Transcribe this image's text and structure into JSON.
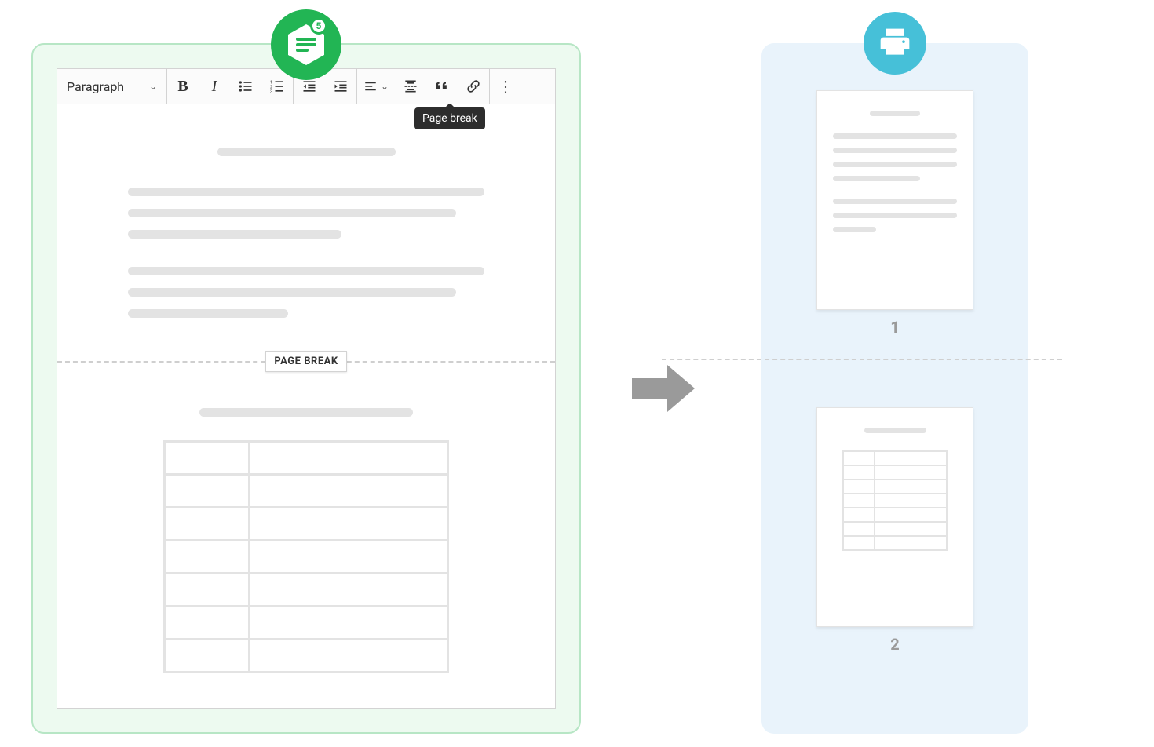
{
  "editor": {
    "badge_number": "5",
    "toolbar": {
      "style_label": "Paragraph",
      "tooltip": "Page break"
    },
    "pagebreak_label": "PAGE BREAK"
  },
  "preview": {
    "page1_num": "1",
    "page2_num": "2"
  },
  "colors": {
    "editor_accent": "#22b554",
    "preview_accent": "#46c0d8"
  }
}
